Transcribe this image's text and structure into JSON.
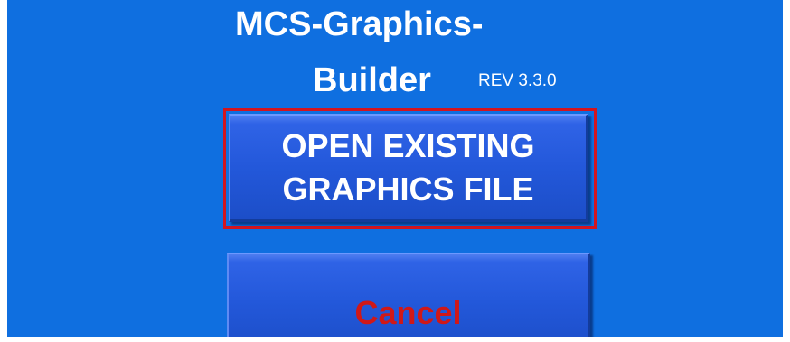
{
  "app": {
    "title_line1": "MCS-Graphics-",
    "title_line2": "Builder",
    "revision": "REV 3.3.0"
  },
  "buttons": {
    "open_label": "OPEN EXISTING\nGRAPHICS FILE",
    "cancel_label": "Cancel"
  },
  "colors": {
    "background": "#0f6fe0",
    "button": "#2358da",
    "highlight": "#d3151f",
    "cancel_text": "#d01818"
  }
}
